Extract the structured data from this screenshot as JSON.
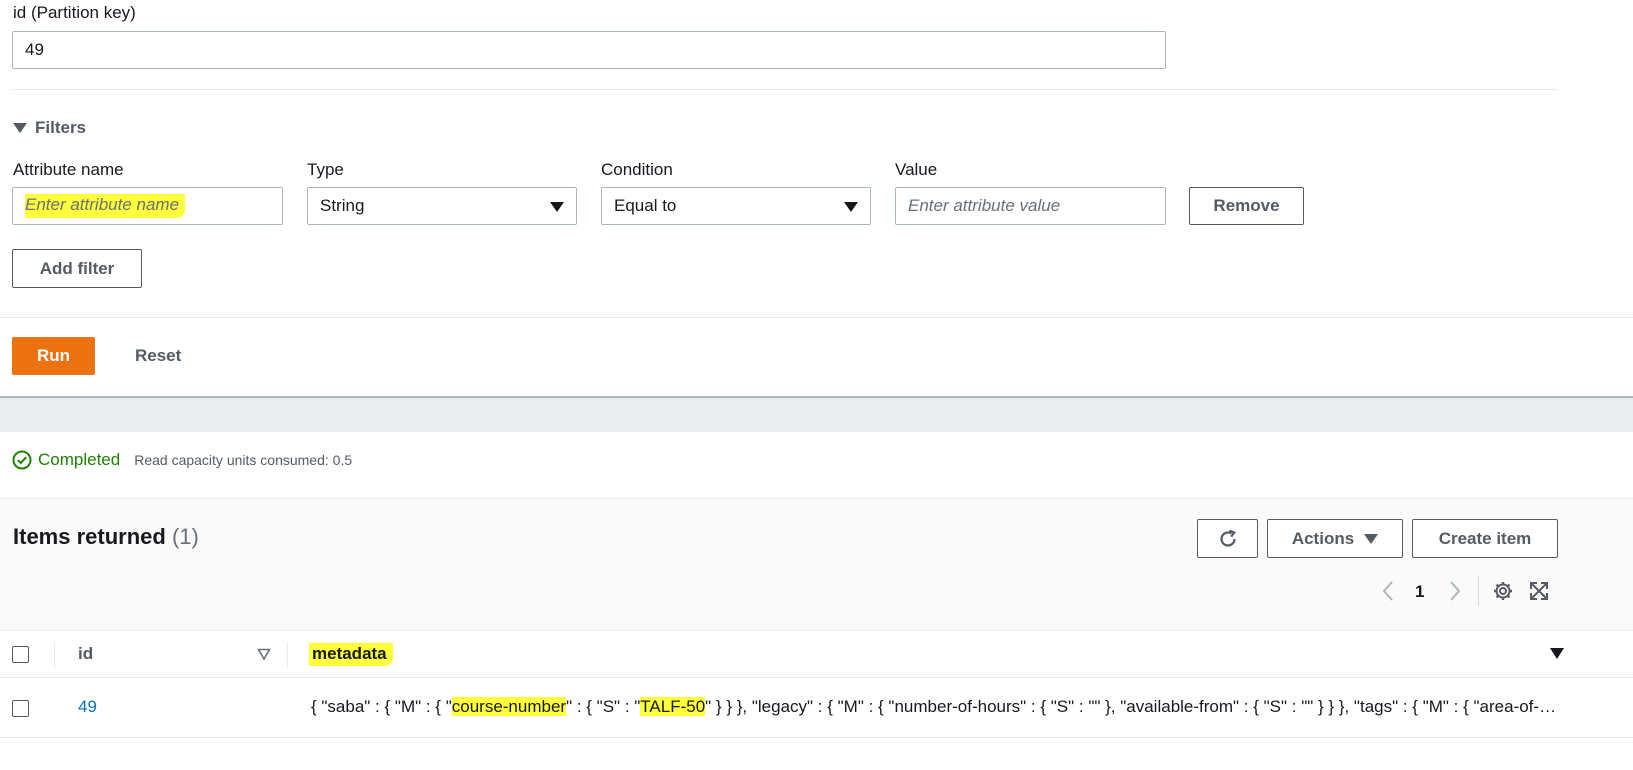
{
  "partition": {
    "label": "id (Partition key)",
    "value": "49"
  },
  "filters": {
    "title": "Filters",
    "columns": {
      "attribute_name": "Attribute name",
      "type": "Type",
      "condition": "Condition",
      "value": "Value"
    },
    "attribute_placeholder": "Enter attribute name",
    "type_selected": "String",
    "condition_selected": "Equal to",
    "value_placeholder": "Enter attribute value",
    "remove_label": "Remove",
    "add_filter_label": "Add filter"
  },
  "actions": {
    "run_label": "Run",
    "reset_label": "Reset"
  },
  "status": {
    "text": "Completed",
    "capacity": "Read capacity units consumed: 0.5"
  },
  "results": {
    "title": "Items returned",
    "count": "(1)",
    "actions_label": "Actions",
    "create_label": "Create item",
    "page_number": "1",
    "columns": [
      "id",
      "metadata"
    ],
    "rows": [
      {
        "id": "49",
        "metadata_parts": [
          "{ \"saba\" : { \"M\" : { \"",
          "course-number",
          "\" : { \"S\" : \"",
          "TALF-50",
          "\" } } }, \"legacy\" : { \"M\" : { \"number-of-hours\" : { \"S\" : \"\" }, \"available-from\" : { \"S\" : \"\" } } }, \"tags\" : { \"M\" : { \"area-of-…"
        ]
      }
    ]
  },
  "colors": {
    "primary": "#ec7211",
    "success": "#1d8102",
    "link": "#0073bb",
    "highlight": "#ffff3b"
  }
}
